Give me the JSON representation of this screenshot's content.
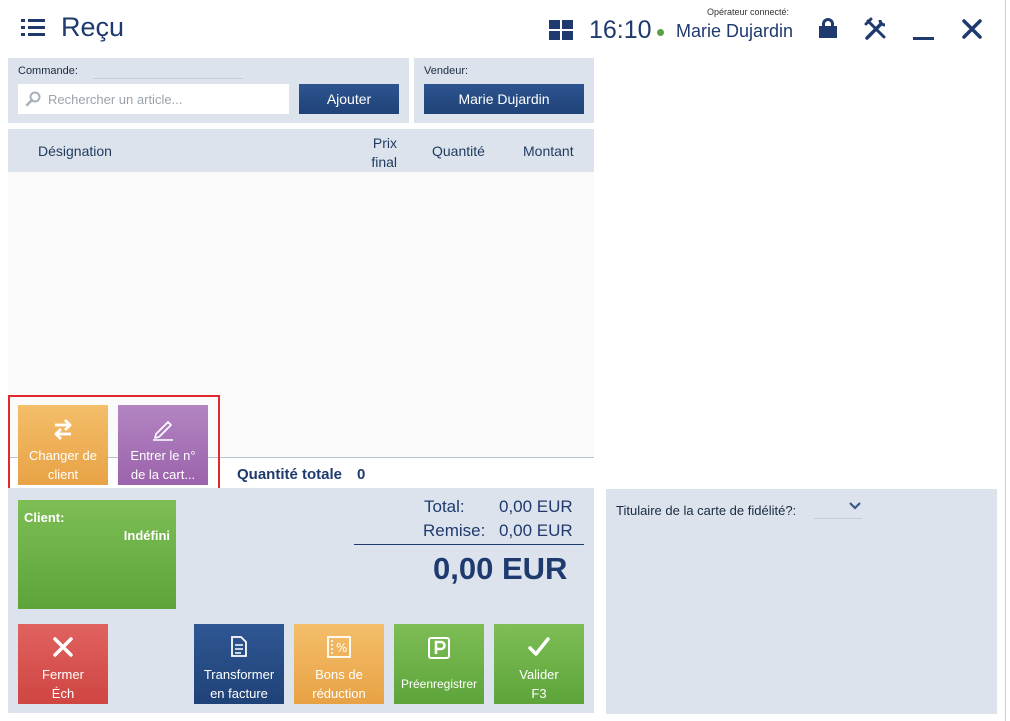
{
  "header": {
    "title": "Reçu",
    "time": "16:10",
    "operator_label": "Opérateur connecté:",
    "operator_name": "Marie Dujardin"
  },
  "order": {
    "label": "Commande:",
    "search_placeholder": "Rechercher un article...",
    "add_label": "Ajouter"
  },
  "vendor": {
    "label": "Vendeur:",
    "name": "Marie Dujardin"
  },
  "table": {
    "columns": [
      "Désignation",
      "Prix final",
      "Quantité",
      "Montant"
    ],
    "col_price_line1": "Prix",
    "col_price_line2": "final",
    "rows": []
  },
  "quantity_total": {
    "label": "Quantité totale",
    "value": "0"
  },
  "actions": {
    "change_client_l1": "Changer de",
    "change_client_l2": "client",
    "enter_card_l1": "Entrer le n°",
    "enter_card_l2": "de la cart..."
  },
  "client": {
    "label": "Client:",
    "value": "Indéfini"
  },
  "totals": {
    "total_label": "Total:",
    "total_value": "0,00 EUR",
    "discount_label": "Remise:",
    "discount_value": "0,00 EUR",
    "grand_total": "0,00 EUR"
  },
  "bottom_buttons": {
    "close_l1": "Fermer",
    "close_l2": "Éch",
    "invoice_l1": "Transformer",
    "invoice_l2": "en facture",
    "vouchers_l1": "Bons de",
    "vouchers_l2": "réduction",
    "preregister": "Préenregistrer",
    "validate_l1": "Valider",
    "validate_l2": "F3"
  },
  "loyalty": {
    "label": "Titulaire de la carte de fidélité?:"
  },
  "colors": {
    "navy": "#1f3a6e",
    "panel": "#dce3ec",
    "orange": "#e8a245",
    "purple": "#9b63ac",
    "green": "#5da43a",
    "red": "#cf4542",
    "highlight": "#e0282e"
  },
  "icons": [
    "menu-icon",
    "grid-icon",
    "lock-icon",
    "tools-icon",
    "minimize-icon",
    "close-icon",
    "search-icon",
    "swap-icon",
    "edit-icon",
    "x-icon",
    "invoice-icon",
    "percent-icon",
    "parking-icon",
    "check-icon",
    "chevron-down-icon"
  ]
}
